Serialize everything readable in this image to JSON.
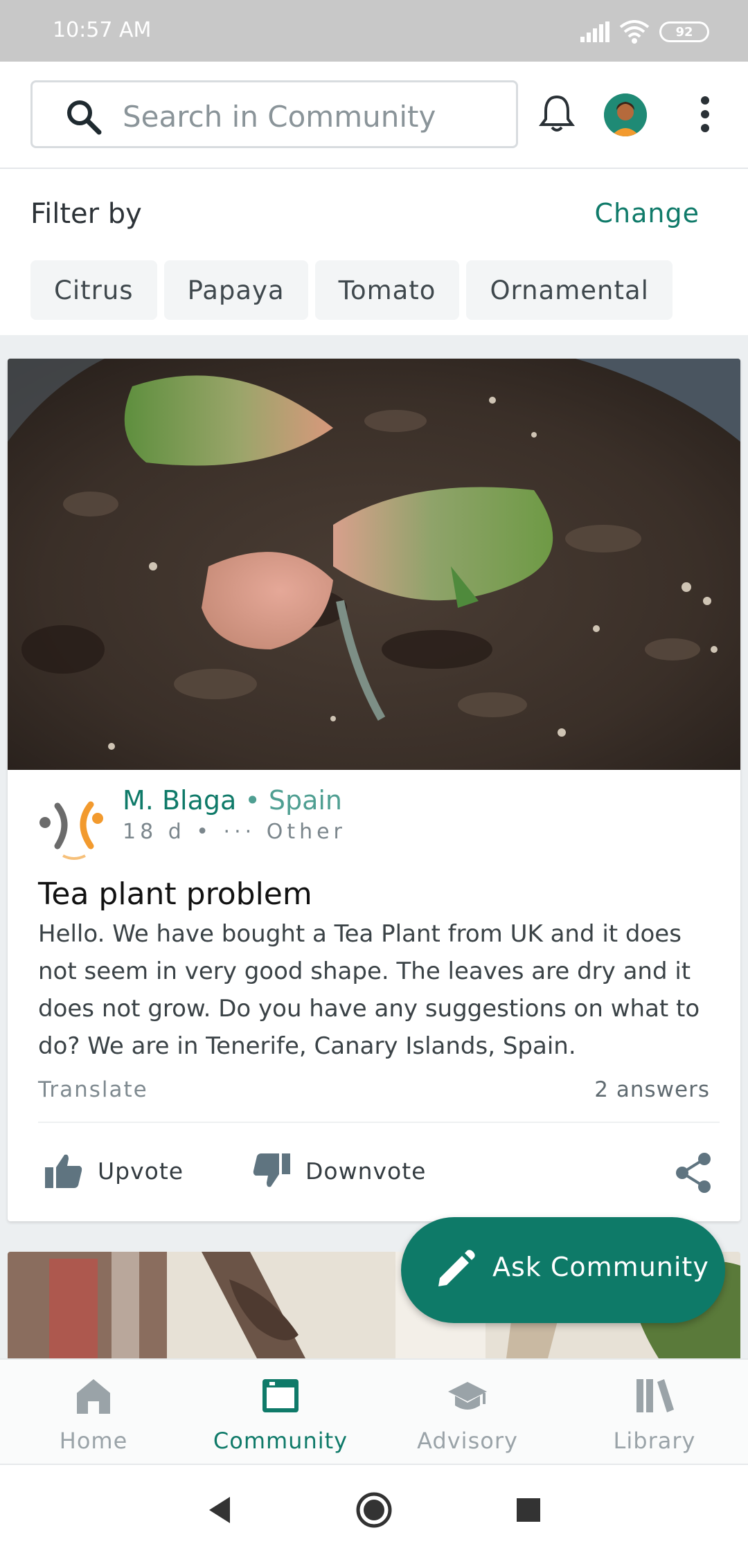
{
  "status_bar": {
    "time": "10:57 AM",
    "battery": "92"
  },
  "search": {
    "placeholder": "Search in Community"
  },
  "filter": {
    "title": "Filter by",
    "change_label": "Change",
    "chips": [
      "Citrus",
      "Papaya",
      "Tomato",
      "Ornamental"
    ]
  },
  "post": {
    "author": "M. Blaga",
    "separator": " • ",
    "country": "Spain",
    "age": "18 d",
    "meta_sep": " • ",
    "crop_prefix": "··· ",
    "crop": "Other",
    "title": "Tea plant problem",
    "body": "Hello. We have bought a Tea Plant from UK and it does not seem in very good shape. The leaves are dry and it does not grow. Do you have any suggestions on what to do? We are in Tenerife, Canary Islands, Spain.",
    "translate_label": "Translate",
    "answers": "2 answers",
    "upvote_label": "Upvote",
    "downvote_label": "Downvote"
  },
  "fab": {
    "label": "Ask Community"
  },
  "bottom_nav": {
    "items": [
      {
        "label": "Home",
        "icon": "home-icon"
      },
      {
        "label": "Community",
        "icon": "community-icon"
      },
      {
        "label": "Advisory",
        "icon": "graduation-cap-icon"
      },
      {
        "label": "Library",
        "icon": "library-icon"
      }
    ],
    "active": "Community"
  },
  "colors": {
    "accent": "#0f7a69",
    "fab": "#0e7a68",
    "status_bar": "#c8c8c8",
    "inactive_nav": "#9aa3a8"
  }
}
